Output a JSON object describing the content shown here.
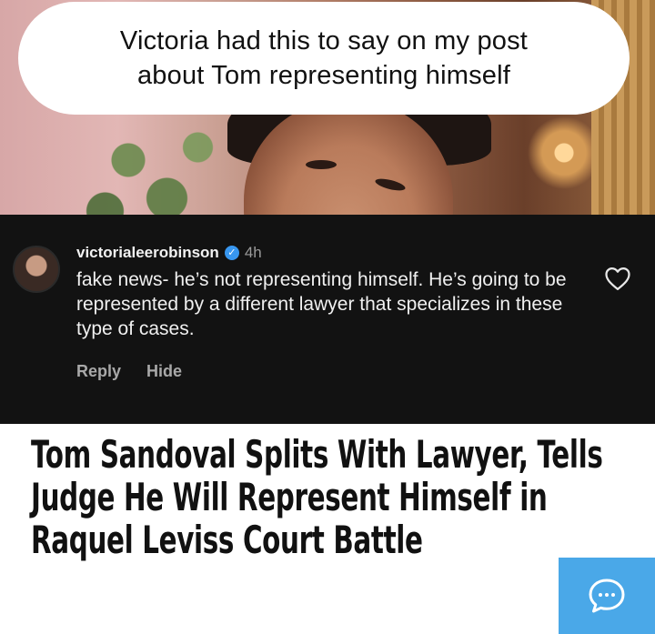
{
  "caption": {
    "text": "Victoria had this to say on my post\nabout Tom representing himself"
  },
  "comment": {
    "username": "victorialeerobinson",
    "time": "4h",
    "body": "fake news- he’s not representing himself. He’s going to be represented by a different lawyer that specializes in these type of cases.",
    "reply_label": "Reply",
    "hide_label": "Hide"
  },
  "article": {
    "headline": "Tom Sandoval Splits With Lawyer, Tells Judge He Will Represent Himself in Raquel Leviss Court Battle"
  },
  "icons": {
    "verified": "verified-badge-icon",
    "like": "heart-icon",
    "chat": "chat-bubble-icon"
  },
  "colors": {
    "comment_background": "#121212",
    "verified_blue": "#3897f0",
    "chat_button": "#4aa8e8"
  }
}
